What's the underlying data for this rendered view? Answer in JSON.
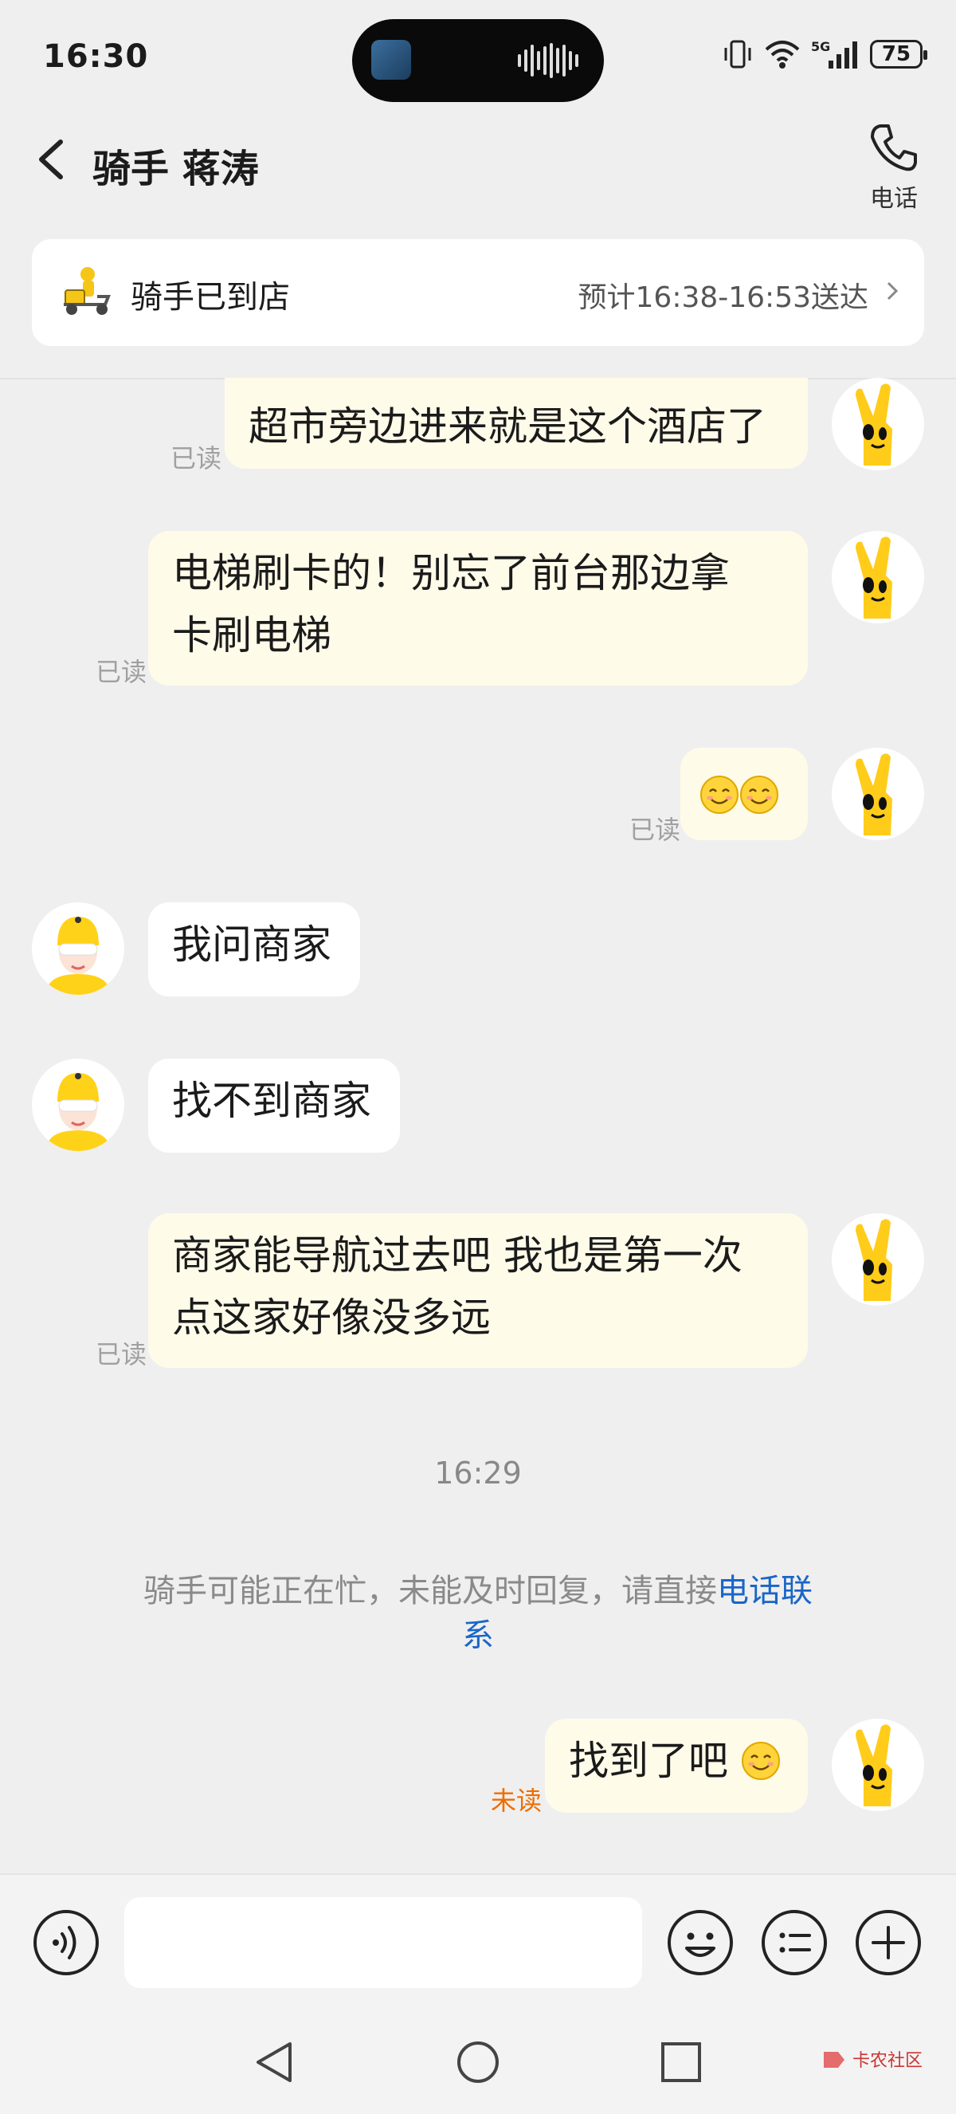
{
  "status_bar": {
    "time": "16:30",
    "battery": "75",
    "network": "5G"
  },
  "header": {
    "title": "骑手 蒋涛",
    "phone_label": "电话"
  },
  "order_card": {
    "status": "骑手已到店",
    "eta": "预计16:38-16:53送达"
  },
  "messages": [
    {
      "from": "me",
      "lines": [
        "超市旁边进来就是这个酒店了"
      ],
      "receipt": "已读"
    },
    {
      "from": "me",
      "lines": [
        "电梯刷卡的！别忘了前台那边拿",
        "卡刷电梯"
      ],
      "receipt": "已读"
    },
    {
      "from": "me",
      "emoji": "smiling-face-icon x2",
      "receipt": "已读"
    },
    {
      "from": "rider",
      "lines": [
        "我问商家"
      ]
    },
    {
      "from": "rider",
      "lines": [
        "找不到商家"
      ]
    },
    {
      "from": "me",
      "lines": [
        "商家能导航过去吧 我也是第一次",
        "点这家好像没多远"
      ],
      "receipt": "已读"
    },
    {
      "from": "me",
      "lines": [
        "找到了吧"
      ],
      "emoji": "smiling-face-icon",
      "receipt": "未读"
    }
  ],
  "timestamp": "16:29",
  "system_note": {
    "text": "骑手可能正在忙，未能及时回复，请直接",
    "link_part1": "电话联",
    "link_part2": "系"
  },
  "input_bar": {
    "placeholder": ""
  },
  "watermark": {
    "text": "卡农社区"
  },
  "colors": {
    "my_bubble": "#fffbe9",
    "rider_bubble": "#ffffff",
    "link": "#1a66c7",
    "unread": "#ef6d00",
    "background": "#efefef"
  }
}
